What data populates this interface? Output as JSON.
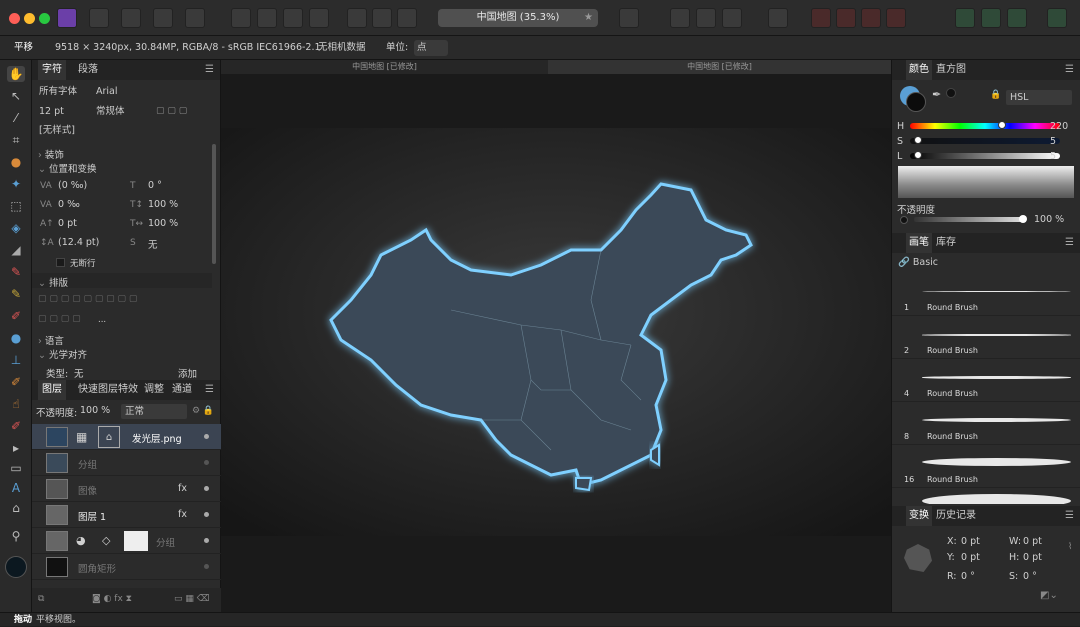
{
  "window": {
    "document_title": "中国地图 (35.3%)",
    "title_star": "★"
  },
  "context_bar": {
    "tool_name": "平移",
    "doc_info": "9518 × 3240px, 30.84MP, RGBA/8 - sRGB IEC61966-2.1",
    "camera": "无相机数据",
    "units_label": "单位:",
    "units_value": "点"
  },
  "doc_tabs": [
    "中国地图 [已修改]",
    "中国地图 [已修改]"
  ],
  "character_panel": {
    "tabs": [
      "字符",
      "段落"
    ],
    "font_collection": "所有字体",
    "font_family": "Arial",
    "font_size": "12 pt",
    "font_style": "常规体",
    "text_style": "[无样式]",
    "sections": {
      "decorations": "装饰",
      "position_transform": "位置和变换",
      "typography": "排版",
      "language": "语言",
      "optical_alignment": "光学对齐"
    },
    "kerning": "(0 ‰)",
    "rotation": "0 °",
    "tracking": "0 ‰",
    "v_scale": "100 %",
    "baseline": "0 pt",
    "h_scale": "100 %",
    "leading": "(12.4 pt)",
    "shear": "无",
    "no_break": "无断行",
    "ellipsis": "...",
    "type_label": "类型:",
    "type_value": "无",
    "add": "添加"
  },
  "layers_panel": {
    "tabs": [
      "图层",
      "快速图层特效",
      "调整",
      "通道"
    ],
    "opacity_label": "不透明度:",
    "opacity_value": "100 %",
    "blend_mode": "正常",
    "layers": [
      {
        "name": "发光层.png",
        "fx": ""
      },
      {
        "name": "分组",
        "fx": ""
      },
      {
        "name": "图像",
        "fx": "fx"
      },
      {
        "name": "图层 1",
        "fx": "fx"
      },
      {
        "name": "分组",
        "fx": ""
      },
      {
        "name": "圆角矩形",
        "fx": ""
      }
    ]
  },
  "color_panel": {
    "tabs": [
      "颜色",
      "直方图"
    ],
    "model": "HSL",
    "h_label": "H",
    "h_value": "220",
    "s_label": "S",
    "s_value": "5",
    "l_label": "L",
    "l_value": "5",
    "opacity_label": "不透明度",
    "opacity_value": "100 %",
    "h_level": 0.61,
    "s_level": 0.05,
    "l_level": 0.05
  },
  "brush_panel": {
    "tabs": [
      "画笔",
      "库存"
    ],
    "category": "Basic",
    "brushes": [
      {
        "size": "1",
        "name": "Round Brush"
      },
      {
        "size": "2",
        "name": "Round Brush"
      },
      {
        "size": "4",
        "name": "Round Brush"
      },
      {
        "size": "8",
        "name": "Round Brush"
      },
      {
        "size": "16",
        "name": "Round Brush"
      }
    ]
  },
  "transform_panel": {
    "tabs": [
      "变换",
      "历史记录"
    ],
    "x_label": "X:",
    "x_value": "0 pt",
    "y_label": "Y:",
    "y_value": "0 pt",
    "w_label": "W:",
    "w_value": "0 pt",
    "h_label": "H:",
    "h_value": "0 pt",
    "r_label": "R:",
    "r_value": "0 °",
    "s_label": "S:",
    "s_value": "0 °"
  },
  "status": {
    "action": "拖动",
    "description": "平移视图。"
  },
  "colors": {
    "accent": "#5a9fd4",
    "glow": "#7fd0ff",
    "map_fill": "#3a4a58"
  }
}
